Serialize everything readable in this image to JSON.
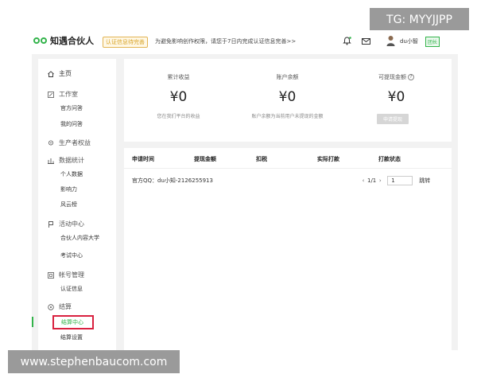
{
  "header": {
    "app_name": "知遇合伙人",
    "cert_tag": "认证信息待完善",
    "notice": "为避免影响创作权限，请您于7日内完成认证信息完善>>",
    "username": "du小智",
    "user_badge": "团长"
  },
  "overlays": {
    "top_right": "TG: MYYJJPP",
    "bottom_left": "www.stephenbaucom.com"
  },
  "sidebar": {
    "home": "主页",
    "workbench": "工作室",
    "workbench_items": [
      "官方问答",
      "我的问答"
    ],
    "producer_rights": "生产者权益",
    "data_stats": "数据统计",
    "data_items": [
      "个人数据",
      "影响力",
      "风云榜"
    ],
    "activity_center": "活动中心",
    "activity_items": [
      "合伙人内容大学",
      "考试中心"
    ],
    "account": "帐号管理",
    "account_items": [
      "认证信息"
    ],
    "settlement": "结算",
    "settlement_items": [
      "结算中心",
      "结算设置"
    ]
  },
  "stats": [
    {
      "title": "累计收益",
      "value": "¥0",
      "desc": "您在我们平台的收益"
    },
    {
      "title": "账户余额",
      "value": "¥0",
      "desc": "账户余额为当前用户未提现的金额"
    },
    {
      "title": "可提现金额",
      "value": "¥0",
      "button": "申请提现"
    }
  ],
  "table": {
    "columns": [
      "申请时间",
      "提现金额",
      "扣税",
      "实际打款",
      "打款状态"
    ],
    "qq_note": "官方QQ：du小知-2126255913",
    "pagination": {
      "page_info": "1/1",
      "current": "1",
      "jump_label": "跳转"
    }
  }
}
